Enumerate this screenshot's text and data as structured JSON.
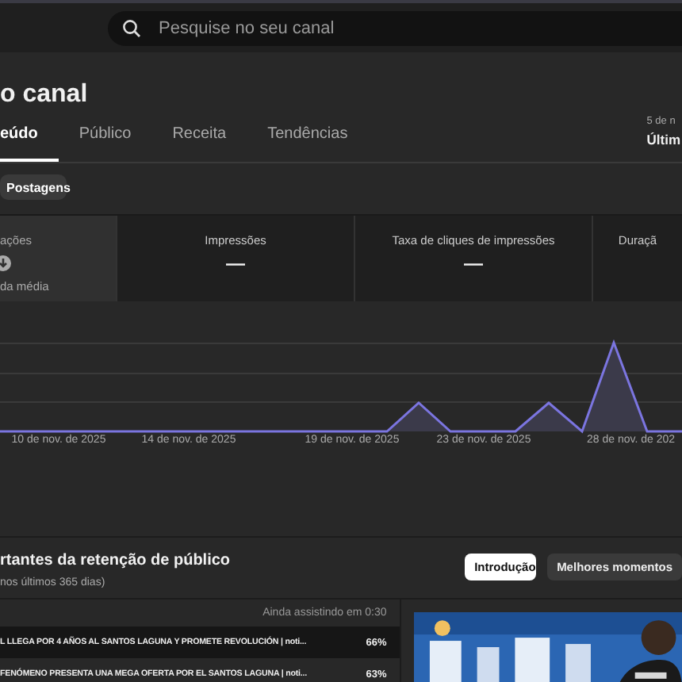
{
  "search": {
    "placeholder": "Pesquise no seu canal"
  },
  "page_title": "o canal",
  "tabs": [
    {
      "label": "eúdo",
      "selected": true
    },
    {
      "label": "Público",
      "selected": false
    },
    {
      "label": "Receita",
      "selected": false
    },
    {
      "label": "Tendências",
      "selected": false
    }
  ],
  "date_range": {
    "dates": "5 de n",
    "label": "Últim"
  },
  "chips": [
    {
      "label": "Postagens",
      "selected": false
    }
  ],
  "metrics": [
    {
      "label": "ações",
      "value_icon": true,
      "note": "da média",
      "selected": true
    },
    {
      "label": "Impressões",
      "value": "—",
      "selected": false
    },
    {
      "label": "Taxa de cliques de impressões",
      "value": "—",
      "selected": false
    },
    {
      "label": "Duraçã",
      "selected": false
    }
  ],
  "chart": {
    "x_labels": [
      "10 de nov. de 2025",
      "14 de nov. de 2025",
      "19 de nov. de 2025",
      "23 de nov. de 2025",
      "28 de nov. de 202"
    ]
  },
  "retention": {
    "title": "rtantes da retenção de público",
    "subtitle": "nos últimos 365 dias)",
    "buttons": [
      {
        "label": "Introdução",
        "selected": true
      },
      {
        "label": "Melhores momentos",
        "selected": false
      }
    ],
    "column_header": "Ainda assistindo em 0:30",
    "rows": [
      {
        "title": "L LLEGA POR 4 AÑOS AL SANTOS LAGUNA Y PROMETE REVOLUCIÓN | noti...",
        "percent": "66%",
        "selected": true
      },
      {
        "title": "FENÓMENO PRESENTA UNA MEGA OFERTA POR EL SANTOS LAGUNA | noti...",
        "percent": "63%",
        "selected": false
      }
    ]
  }
}
